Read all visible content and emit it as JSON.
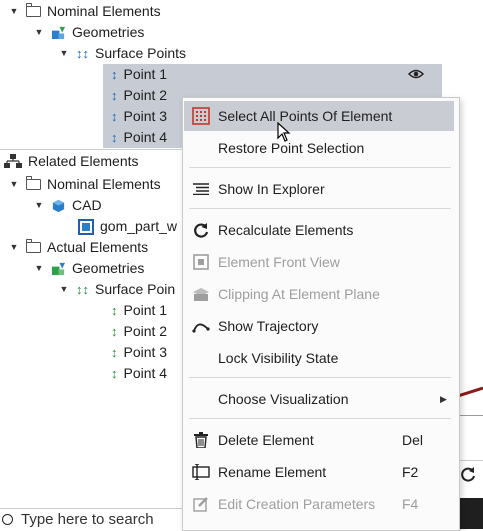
{
  "top_tree": {
    "nominal_elements": "Nominal Elements",
    "geometries": "Geometries",
    "surface_points": "Surface Points",
    "points": [
      "Point 1",
      "Point 2",
      "Point 3",
      "Point 4"
    ]
  },
  "related": {
    "header": "Related Elements",
    "nominal_elements": "Nominal Elements",
    "cad": "CAD",
    "part": "gom_part_w",
    "actual_elements": "Actual Elements",
    "geometries": "Geometries",
    "surface_points": "Surface Poin",
    "points": [
      "Point 1",
      "Point 2",
      "Point 3",
      "Point 4"
    ]
  },
  "context_menu": {
    "items": [
      {
        "label": "Select All Points Of Element",
        "icon": "select-points-icon"
      },
      {
        "label": "Restore Point Selection"
      },
      {
        "label": "Show In Explorer",
        "icon": "list-icon"
      },
      {
        "label": "Recalculate Elements",
        "icon": "recalculate-icon"
      },
      {
        "label": "Element Front View",
        "icon": "front-view-icon",
        "disabled": true
      },
      {
        "label": "Clipping At Element Plane",
        "icon": "clipping-icon",
        "disabled": true
      },
      {
        "label": "Show Trajectory",
        "icon": "trajectory-icon"
      },
      {
        "label": "Lock Visibility State"
      },
      {
        "label": "Choose Visualization"
      },
      {
        "label": "Delete Element",
        "icon": "trash-icon",
        "shortcut": "Del"
      },
      {
        "label": "Rename Element",
        "icon": "rename-icon",
        "shortcut": "F2"
      },
      {
        "label": "Edit Creation Parameters",
        "icon": "edit-icon",
        "shortcut": "F4",
        "disabled": true
      }
    ]
  },
  "search": {
    "placeholder": "Type here to search"
  },
  "colors": {
    "selection": "#c7cbd3",
    "accent": "#1f6bb5",
    "green": "#2e8b3e"
  }
}
